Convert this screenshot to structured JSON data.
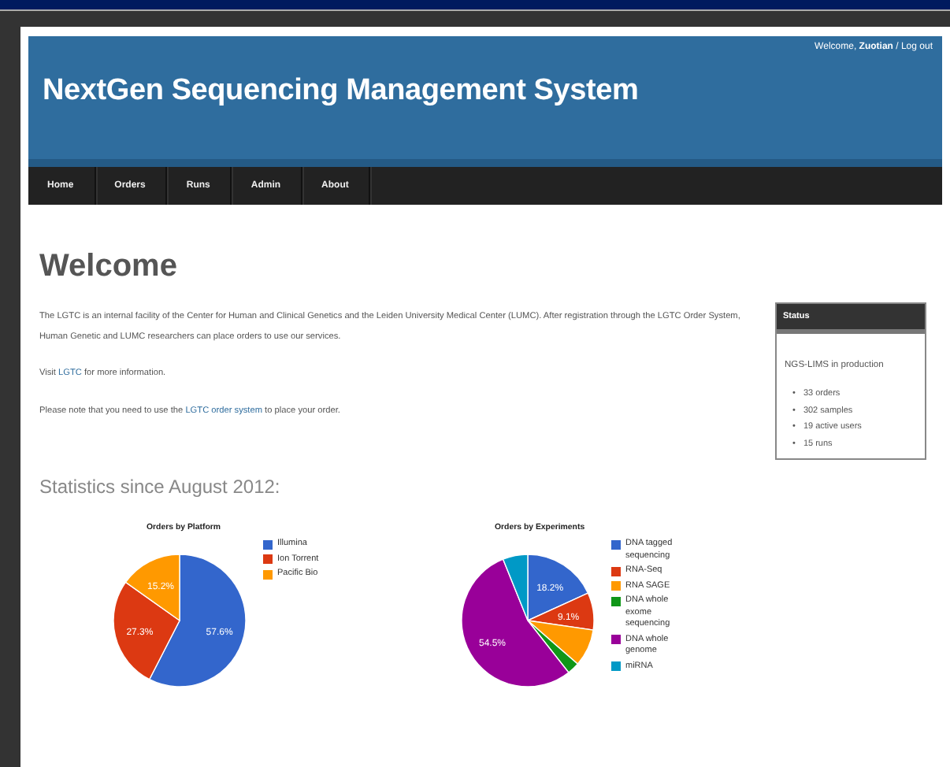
{
  "header": {
    "user_greeting": "Welcome,",
    "user_name": "Zuotian",
    "separator": "/",
    "logout": "Log out",
    "title": "NextGen Sequencing Management System"
  },
  "nav": [
    {
      "label": "Home"
    },
    {
      "label": "Orders"
    },
    {
      "label": "Runs"
    },
    {
      "label": "Admin"
    },
    {
      "label": "About"
    }
  ],
  "heading": "Welcome",
  "intro": "The LGTC is an internal facility of the Center for Human and Clinical Genetics and the Leiden University Medical Center (LUMC). After registration through the LGTC Order System, Human Genetic and LUMC researchers can place orders to use our services.",
  "visit": {
    "before": "Visit",
    "link": "LGTC",
    "after": "for more information."
  },
  "note": {
    "before": "Please note that you need to use the",
    "link": "LGTC order system",
    "after": "to place your order."
  },
  "status": {
    "title": "Status",
    "line": "NGS-LIMS in production",
    "marker": "•",
    "items": [
      "33 orders",
      "302 samples",
      "19 active users",
      "15 runs"
    ]
  },
  "stats_heading": "Statistics since August 2012:",
  "charts": [
    {
      "chart_data": {
        "type": "pie",
        "title": "Orders by Platform",
        "categories": [
          "Illumina",
          "Ion Torrent",
          "Pacific Bio"
        ],
        "values": [
          57.6,
          27.3,
          15.2
        ],
        "legend": true,
        "colors": [
          "#3366cc",
          "#dc3912",
          "#ff9900"
        ],
        "value_labels": [
          "57.6%",
          "27.3%",
          "15.2%"
        ]
      }
    },
    {
      "chart_data": {
        "type": "pie",
        "title": "Orders by Experiments",
        "categories": [
          "DNA tagged sequencing",
          "RNA-Seq",
          "RNA SAGE",
          "DNA whole exome sequencing",
          "DNA whole genome",
          "miRNA"
        ],
        "values": [
          18.2,
          9.1,
          9.1,
          3.0,
          54.5,
          6.1
        ],
        "legend": true,
        "colors": [
          "#3366cc",
          "#dc3912",
          "#ff9900",
          "#109618",
          "#990099",
          "#0099c6"
        ],
        "value_labels": [
          "18.2%",
          "9.1%",
          null,
          null,
          "54.5%",
          null
        ]
      }
    }
  ]
}
